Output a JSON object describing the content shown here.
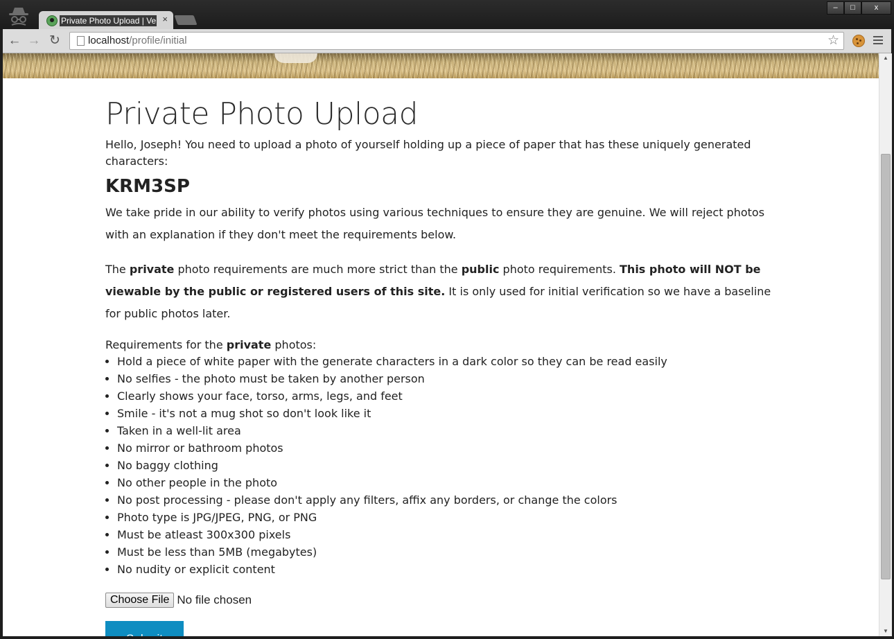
{
  "browser": {
    "tab_title": "Private Photo Upload | Ve",
    "tab_close": "×",
    "url_host": "localhost",
    "url_path": "/profile/initial",
    "window_min": "–",
    "window_max": "□",
    "window_close": "x",
    "icons": {
      "back": "←",
      "forward": "→",
      "reload": "↻",
      "bookmark": "☆"
    }
  },
  "page": {
    "title": "Private Photo Upload",
    "greeting": "Hello, Joseph! You need to upload a photo of yourself holding up a piece of paper that has these uniquely generated characters:",
    "code": "KRM3SP",
    "intro": "We take pride in our ability to verify photos using various techniques to ensure they are genuine. We will reject photos with an explanation if they don't meet the requirements below.",
    "strict": {
      "t1": "The ",
      "b1": "private",
      "t2": " photo requirements are much more strict than the ",
      "b2": "public",
      "t3": " photo requirements. ",
      "b3": "This photo will NOT be viewable by the public or registered users of this site.",
      "t4": " It is only used for initial verification so we have a baseline for public photos later."
    },
    "requirements_intro": {
      "t1": "Requirements for the ",
      "b1": "private",
      "t2": " photos:"
    },
    "requirements": [
      "Hold a piece of white paper with the generate characters in a dark color so they can be read easily",
      "No selfies - the photo must be taken by another person",
      "Clearly shows your face, torso, arms, legs, and feet",
      "Smile - it's not a mug shot so don't look like it",
      "Taken in a well-lit area",
      "No mirror or bathroom photos",
      "No baggy clothing",
      "No other people in the photo",
      "No post processing - please don't apply any filters, affix any borders, or change the colors",
      "Photo type is JPG/JPEG, PNG, or PNG",
      "Must be atleast 300x300 pixels",
      "Must be less than 5MB (megabytes)",
      "No nudity or explicit content"
    ],
    "file_button": "Choose File",
    "file_status": "No file chosen",
    "submit": "Submit"
  },
  "colors": {
    "submit_bg": "#0e8dc1",
    "tab_bg": "#d4d4d4",
    "titlebar_bg": "#1e1e1e"
  }
}
